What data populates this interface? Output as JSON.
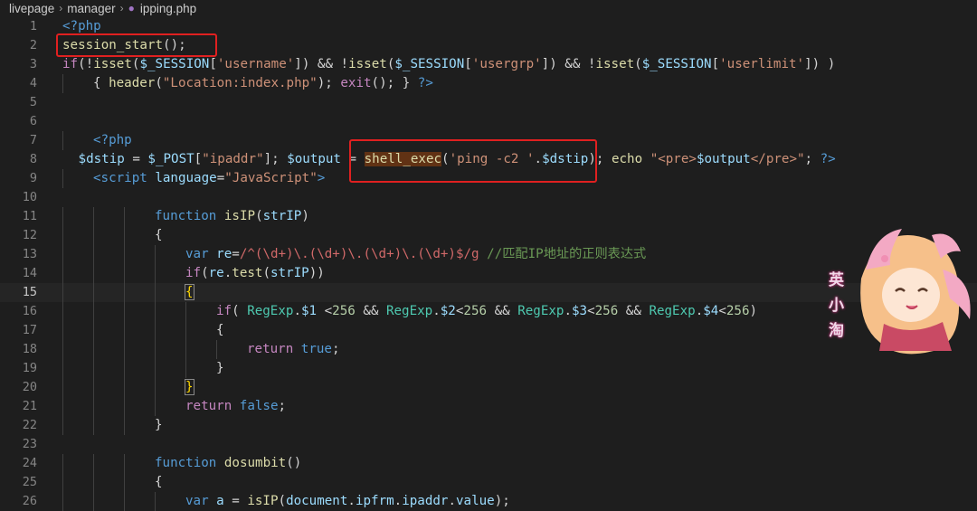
{
  "breadcrumb": {
    "items": [
      "livepage",
      "manager",
      "ipping.php"
    ],
    "file_icon": "php-elephant-icon"
  },
  "editor": {
    "current_line": 15,
    "lines": [
      {
        "n": "1",
        "indent": 0,
        "tokens": [
          [
            "tag",
            "<?php"
          ]
        ]
      },
      {
        "n": "2",
        "indent": 0,
        "tokens": [
          [
            "fn",
            "session_start"
          ],
          [
            "op",
            "();"
          ]
        ]
      },
      {
        "n": "3",
        "indent": 0,
        "tokens": [
          [
            "kw",
            "if"
          ],
          [
            "op",
            "(!"
          ],
          [
            "fn",
            "isset"
          ],
          [
            "op",
            "("
          ],
          [
            "var",
            "$_SESSION"
          ],
          [
            "op",
            "["
          ],
          [
            "str",
            "'username'"
          ],
          [
            "op",
            "]) && !"
          ],
          [
            "fn",
            "isset"
          ],
          [
            "op",
            "("
          ],
          [
            "var",
            "$_SESSION"
          ],
          [
            "op",
            "["
          ],
          [
            "str",
            "'usergrp'"
          ],
          [
            "op",
            "]) && !"
          ],
          [
            "fn",
            "isset"
          ],
          [
            "op",
            "("
          ],
          [
            "var",
            "$_SESSION"
          ],
          [
            "op",
            "["
          ],
          [
            "str",
            "'userlimit'"
          ],
          [
            "op",
            "]) )"
          ]
        ]
      },
      {
        "n": "4",
        "indent": 1,
        "tokens": [
          [
            "op",
            "{ "
          ],
          [
            "fn",
            "header"
          ],
          [
            "op",
            "("
          ],
          [
            "str",
            "\"Location:index.php\""
          ],
          [
            "op",
            "); "
          ],
          [
            "kw",
            "exit"
          ],
          [
            "op",
            "(); } "
          ],
          [
            "tag",
            "?>"
          ]
        ]
      },
      {
        "n": "5",
        "indent": 0,
        "tokens": []
      },
      {
        "n": "6",
        "indent": 0,
        "tokens": []
      },
      {
        "n": "7",
        "indent": 1,
        "tokens": [
          [
            "tag",
            "<?php"
          ]
        ]
      },
      {
        "n": "8",
        "indent": 0,
        "tokens": [
          [
            "op",
            " "
          ],
          [
            "var",
            "$dstip"
          ],
          [
            "op",
            " = "
          ],
          [
            "var",
            "$_POST"
          ],
          [
            "op",
            "["
          ],
          [
            "str",
            "\"ipaddr\""
          ],
          [
            "op",
            "]; "
          ],
          [
            "var",
            "$output"
          ],
          [
            "op",
            " = "
          ],
          [
            "fnhl",
            "shell_exec"
          ],
          [
            "op",
            "("
          ],
          [
            "str",
            "'ping -c2 '"
          ],
          [
            "op",
            "."
          ],
          [
            "var",
            "$dstip"
          ],
          [
            "op",
            "); "
          ],
          [
            "fn",
            "echo"
          ],
          [
            "op",
            " "
          ],
          [
            "str",
            "\"<pre>"
          ],
          [
            "var",
            "$output"
          ],
          [
            "str",
            "</pre>\""
          ],
          [
            "op",
            "; "
          ],
          [
            "tag",
            "?>"
          ]
        ]
      },
      {
        "n": "9",
        "indent": 1,
        "tokens": [
          [
            "tag",
            "<script"
          ],
          [
            "op",
            " "
          ],
          [
            "var",
            "language"
          ],
          [
            "op",
            "="
          ],
          [
            "str",
            "\"JavaScript\""
          ],
          [
            "tag",
            ">"
          ]
        ]
      },
      {
        "n": "10",
        "indent": 0,
        "tokens": []
      },
      {
        "n": "11",
        "indent": 3,
        "tokens": [
          [
            "dk",
            "function"
          ],
          [
            "op",
            " "
          ],
          [
            "fn",
            "isIP"
          ],
          [
            "op",
            "("
          ],
          [
            "var",
            "strIP"
          ],
          [
            "op",
            ")"
          ]
        ]
      },
      {
        "n": "12",
        "indent": 3,
        "tokens": [
          [
            "op",
            "{"
          ]
        ]
      },
      {
        "n": "13",
        "indent": 4,
        "tokens": [
          [
            "dk",
            "var"
          ],
          [
            "op",
            " "
          ],
          [
            "var",
            "re"
          ],
          [
            "op",
            "="
          ],
          [
            "reg",
            "/^(\\d+)\\.(\\d+)\\.(\\d+)\\.(\\d+)$/g"
          ],
          [
            "op",
            " "
          ],
          [
            "cmt",
            "//匹配IP地址的正则表达式"
          ]
        ]
      },
      {
        "n": "14",
        "indent": 4,
        "tokens": [
          [
            "kw",
            "if"
          ],
          [
            "op",
            "("
          ],
          [
            "var",
            "re"
          ],
          [
            "op",
            "."
          ],
          [
            "fn",
            "test"
          ],
          [
            "op",
            "("
          ],
          [
            "var",
            "strIP"
          ],
          [
            "op",
            "))"
          ]
        ]
      },
      {
        "n": "15",
        "indent": 4,
        "tokens": [
          [
            "brm",
            "{"
          ]
        ]
      },
      {
        "n": "16",
        "indent": 5,
        "tokens": [
          [
            "kw",
            "if"
          ],
          [
            "op",
            "( "
          ],
          [
            "cls",
            "RegExp"
          ],
          [
            "op",
            "."
          ],
          [
            "var",
            "$1"
          ],
          [
            "op",
            " <"
          ],
          [
            "num",
            "256"
          ],
          [
            "op",
            " && "
          ],
          [
            "cls",
            "RegExp"
          ],
          [
            "op",
            "."
          ],
          [
            "var",
            "$2"
          ],
          [
            "op",
            "<"
          ],
          [
            "num",
            "256"
          ],
          [
            "op",
            " && "
          ],
          [
            "cls",
            "RegExp"
          ],
          [
            "op",
            "."
          ],
          [
            "var",
            "$3"
          ],
          [
            "op",
            "<"
          ],
          [
            "num",
            "256"
          ],
          [
            "op",
            " && "
          ],
          [
            "cls",
            "RegExp"
          ],
          [
            "op",
            "."
          ],
          [
            "var",
            "$4"
          ],
          [
            "op",
            "<"
          ],
          [
            "num",
            "256"
          ],
          [
            "op",
            ")"
          ]
        ]
      },
      {
        "n": "17",
        "indent": 5,
        "tokens": [
          [
            "op",
            "{"
          ]
        ]
      },
      {
        "n": "18",
        "indent": 6,
        "tokens": [
          [
            "kw",
            "return"
          ],
          [
            "op",
            " "
          ],
          [
            "dk",
            "true"
          ],
          [
            "op",
            ";"
          ]
        ]
      },
      {
        "n": "19",
        "indent": 5,
        "tokens": [
          [
            "op",
            "}"
          ]
        ]
      },
      {
        "n": "20",
        "indent": 4,
        "tokens": [
          [
            "brm",
            "}"
          ]
        ]
      },
      {
        "n": "21",
        "indent": 4,
        "tokens": [
          [
            "kw",
            "return"
          ],
          [
            "op",
            " "
          ],
          [
            "dk",
            "false"
          ],
          [
            "op",
            ";"
          ]
        ]
      },
      {
        "n": "22",
        "indent": 3,
        "tokens": [
          [
            "op",
            "}"
          ]
        ]
      },
      {
        "n": "23",
        "indent": 0,
        "tokens": []
      },
      {
        "n": "24",
        "indent": 3,
        "tokens": [
          [
            "dk",
            "function"
          ],
          [
            "op",
            " "
          ],
          [
            "fn",
            "dosumbit"
          ],
          [
            "op",
            "()"
          ]
        ]
      },
      {
        "n": "25",
        "indent": 3,
        "tokens": [
          [
            "op",
            "{"
          ]
        ]
      },
      {
        "n": "26",
        "indent": 4,
        "tokens": [
          [
            "dk",
            "var"
          ],
          [
            "op",
            " "
          ],
          [
            "var",
            "a"
          ],
          [
            "op",
            " = "
          ],
          [
            "fn",
            "isIP"
          ],
          [
            "op",
            "("
          ],
          [
            "var",
            "document"
          ],
          [
            "op",
            "."
          ],
          [
            "var",
            "ipfrm"
          ],
          [
            "op",
            "."
          ],
          [
            "var",
            "ipaddr"
          ],
          [
            "op",
            "."
          ],
          [
            "var",
            "value"
          ],
          [
            "op",
            ");"
          ]
        ]
      }
    ]
  },
  "annotations": {
    "highlight_color": "#e02020",
    "boxes": [
      "session_start",
      "shell_exec"
    ]
  },
  "sticker": {
    "name": "anime-sticker-icon",
    "caption": [
      "英",
      "小",
      "淘"
    ]
  }
}
